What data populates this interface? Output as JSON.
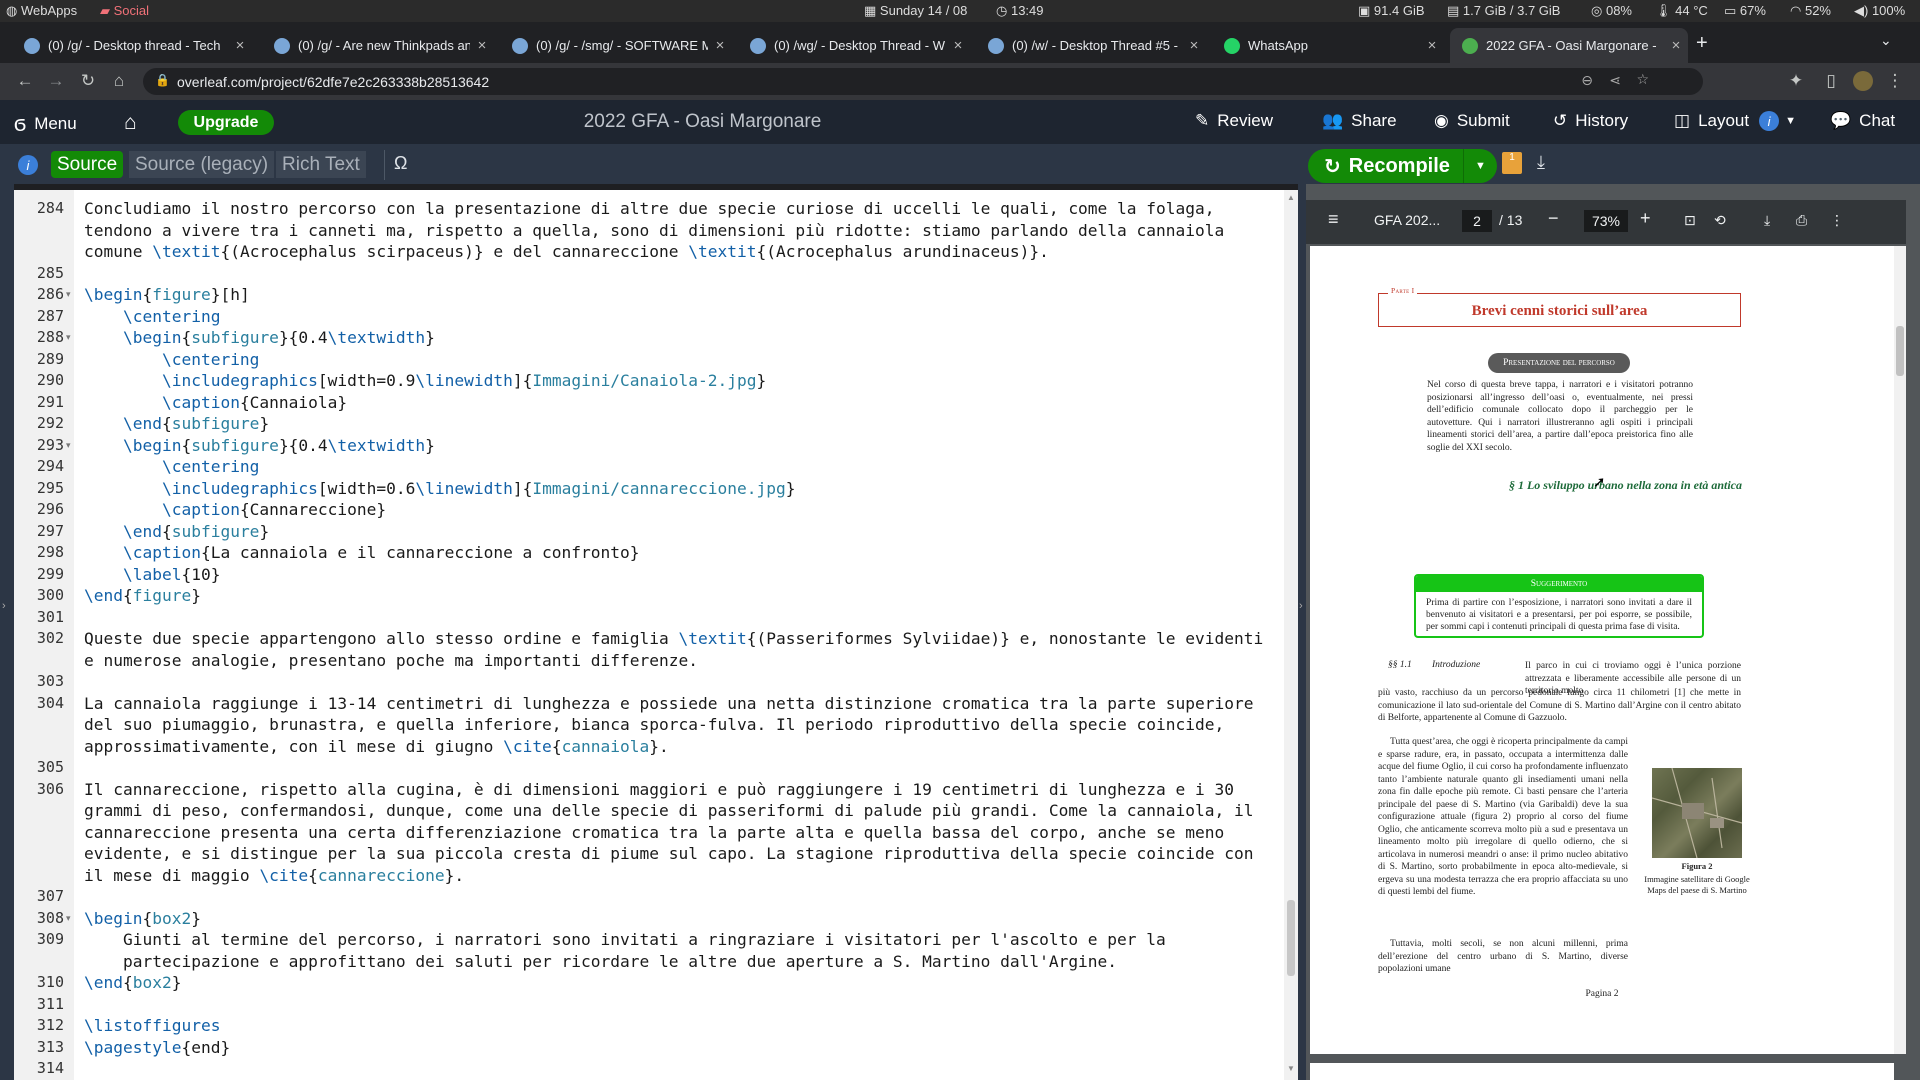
{
  "system_bar": {
    "webapps": "WebApps",
    "social": "Social",
    "date": "Sunday 14 / 08",
    "time": "13:49",
    "disk": "91.4 GiB",
    "memory": "1.7 GiB / 3.7 GiB",
    "cpu": "08%",
    "temp": "44 °C",
    "battery": "67%",
    "wifi": "52%",
    "volume": "100%"
  },
  "browser": {
    "tabs": [
      {
        "title": "(0) /g/ - Desktop thread - Tech",
        "favicon_color": "#7aa6d6"
      },
      {
        "title": "(0) /g/ - Are new Thinkpads an",
        "favicon_color": "#7aa6d6"
      },
      {
        "title": "(0) /g/ - /smg/ - SOFTWARE M",
        "favicon_color": "#7aa6d6"
      },
      {
        "title": "(0) /wg/ - Desktop Thread - W",
        "favicon_color": "#7aa6d6"
      },
      {
        "title": "(0) /w/ - Desktop Thread #5 -",
        "favicon_color": "#7aa6d6"
      },
      {
        "title": "WhatsApp",
        "favicon_color": "#25d366"
      },
      {
        "title": "2022 GFA - Oasi Margonare -",
        "favicon_color": "#4cae4f"
      }
    ],
    "new_tab": "+",
    "url": "overleaf.com/project/62dfe7e2c263338b28513642"
  },
  "overleaf": {
    "menu": "Menu",
    "upgrade": "Upgrade",
    "project_title": "2022 GFA - Oasi Margonare",
    "review": "Review",
    "share": "Share",
    "submit": "Submit",
    "history": "History",
    "layout": "Layout",
    "chat": "Chat",
    "modes": {
      "source": "Source",
      "legacy": "Source (legacy)",
      "rich": "Rich Text"
    },
    "omega": "Ω",
    "recompile": "Recompile",
    "logs_badge": "1"
  },
  "editor_lines": [
    {
      "n": "284",
      "fold": "",
      "segs": [
        {
          "t": "Concludiamo il nostro percorso con la presentazione di altre due specie curiose di uccelli le quali, come la folaga,"
        }
      ]
    },
    {
      "n": "",
      "fold": "",
      "segs": [
        {
          "t": "tendono a vivere tra i canneti ma, rispetto a quella, sono di dimensioni più ridotte: stiamo parlando della cannaiola"
        }
      ]
    },
    {
      "n": "",
      "fold": "",
      "segs": [
        {
          "t": "comune "
        },
        {
          "t": "\\textit",
          "c": "cmd"
        },
        {
          "t": "{(Acrocephalus scirpaceus)} e del cannareccione "
        },
        {
          "t": "\\textit",
          "c": "cmd"
        },
        {
          "t": "{(Acrocephalus arundinaceus)}."
        }
      ]
    },
    {
      "n": "285",
      "fold": "",
      "segs": [
        {
          "t": ""
        }
      ]
    },
    {
      "n": "286",
      "fold": "▾",
      "segs": [
        {
          "t": "\\begin",
          "c": "cmd"
        },
        {
          "t": "{"
        },
        {
          "t": "figure",
          "c": "arg"
        },
        {
          "t": "}[h]"
        }
      ]
    },
    {
      "n": "287",
      "fold": "",
      "segs": [
        {
          "t": "    "
        },
        {
          "t": "\\centering",
          "c": "cmd"
        }
      ]
    },
    {
      "n": "288",
      "fold": "▾",
      "segs": [
        {
          "t": "    "
        },
        {
          "t": "\\begin",
          "c": "cmd"
        },
        {
          "t": "{"
        },
        {
          "t": "subfigure",
          "c": "arg"
        },
        {
          "t": "}{0.4"
        },
        {
          "t": "\\textwidth",
          "c": "cmd"
        },
        {
          "t": "}"
        }
      ]
    },
    {
      "n": "289",
      "fold": "",
      "segs": [
        {
          "t": "        "
        },
        {
          "t": "\\centering",
          "c": "cmd"
        }
      ]
    },
    {
      "n": "290",
      "fold": "",
      "segs": [
        {
          "t": "        "
        },
        {
          "t": "\\includegraphics",
          "c": "cmd"
        },
        {
          "t": "[width=0.9"
        },
        {
          "t": "\\linewidth",
          "c": "cmd"
        },
        {
          "t": "]{"
        },
        {
          "t": "Immagini/Canaiola-2.jpg",
          "c": "arg"
        },
        {
          "t": "}"
        }
      ]
    },
    {
      "n": "291",
      "fold": "",
      "segs": [
        {
          "t": "        "
        },
        {
          "t": "\\caption",
          "c": "cmd"
        },
        {
          "t": "{Cannaiola}"
        }
      ]
    },
    {
      "n": "292",
      "fold": "",
      "segs": [
        {
          "t": "    "
        },
        {
          "t": "\\end",
          "c": "cmd"
        },
        {
          "t": "{"
        },
        {
          "t": "subfigure",
          "c": "arg"
        },
        {
          "t": "}"
        }
      ]
    },
    {
      "n": "293",
      "fold": "▾",
      "segs": [
        {
          "t": "    "
        },
        {
          "t": "\\begin",
          "c": "cmd"
        },
        {
          "t": "{"
        },
        {
          "t": "subfigure",
          "c": "arg"
        },
        {
          "t": "}{0.4"
        },
        {
          "t": "\\textwidth",
          "c": "cmd"
        },
        {
          "t": "}"
        }
      ]
    },
    {
      "n": "294",
      "fold": "",
      "segs": [
        {
          "t": "        "
        },
        {
          "t": "\\centering",
          "c": "cmd"
        }
      ]
    },
    {
      "n": "295",
      "fold": "",
      "segs": [
        {
          "t": "        "
        },
        {
          "t": "\\includegraphics",
          "c": "cmd"
        },
        {
          "t": "[width=0.6"
        },
        {
          "t": "\\linewidth",
          "c": "cmd"
        },
        {
          "t": "]{"
        },
        {
          "t": "Immagini/cannareccione.jpg",
          "c": "arg"
        },
        {
          "t": "}"
        }
      ]
    },
    {
      "n": "296",
      "fold": "",
      "segs": [
        {
          "t": "        "
        },
        {
          "t": "\\caption",
          "c": "cmd"
        },
        {
          "t": "{Cannareccione}"
        }
      ]
    },
    {
      "n": "297",
      "fold": "",
      "segs": [
        {
          "t": "    "
        },
        {
          "t": "\\end",
          "c": "cmd"
        },
        {
          "t": "{"
        },
        {
          "t": "subfigure",
          "c": "arg"
        },
        {
          "t": "}"
        }
      ]
    },
    {
      "n": "298",
      "fold": "",
      "segs": [
        {
          "t": "    "
        },
        {
          "t": "\\caption",
          "c": "cmd"
        },
        {
          "t": "{La cannaiola e il cannareccione a confronto}"
        }
      ]
    },
    {
      "n": "299",
      "fold": "",
      "segs": [
        {
          "t": "    "
        },
        {
          "t": "\\label",
          "c": "cmd"
        },
        {
          "t": "{10}"
        }
      ]
    },
    {
      "n": "300",
      "fold": "",
      "segs": [
        {
          "t": "\\end",
          "c": "cmd"
        },
        {
          "t": "{"
        },
        {
          "t": "figure",
          "c": "arg"
        },
        {
          "t": "}"
        }
      ]
    },
    {
      "n": "301",
      "fold": "",
      "segs": [
        {
          "t": ""
        }
      ]
    },
    {
      "n": "302",
      "fold": "",
      "segs": [
        {
          "t": "Queste due specie appartengono allo stesso ordine e famiglia "
        },
        {
          "t": "\\textit",
          "c": "cmd"
        },
        {
          "t": "{(Passeriformes Sylviidae)} e, nonostante le evidenti"
        }
      ]
    },
    {
      "n": "",
      "fold": "",
      "segs": [
        {
          "t": "e numerose analogie, presentano poche ma importanti differenze."
        }
      ]
    },
    {
      "n": "303",
      "fold": "",
      "segs": [
        {
          "t": ""
        }
      ]
    },
    {
      "n": "304",
      "fold": "",
      "segs": [
        {
          "t": "La cannaiola raggiunge i 13-14 centimetri di lunghezza e possiede una netta distinzione cromatica tra la parte superiore"
        }
      ]
    },
    {
      "n": "",
      "fold": "",
      "segs": [
        {
          "t": "del suo piumaggio, brunastra, e quella inferiore, bianca sporca-fulva. Il periodo riproduttivo della specie coincide,"
        }
      ]
    },
    {
      "n": "",
      "fold": "",
      "segs": [
        {
          "t": "approssimativamente, con il mese di giugno "
        },
        {
          "t": "\\cite",
          "c": "cmd"
        },
        {
          "t": "{"
        },
        {
          "t": "cannaiola",
          "c": "arg"
        },
        {
          "t": "}."
        }
      ]
    },
    {
      "n": "305",
      "fold": "",
      "segs": [
        {
          "t": ""
        }
      ]
    },
    {
      "n": "306",
      "fold": "",
      "segs": [
        {
          "t": "Il cannareccione, rispetto alla cugina, è di dimensioni maggiori e può raggiungere i 19 centimetri di lunghezza e i 30"
        }
      ]
    },
    {
      "n": "",
      "fold": "",
      "segs": [
        {
          "t": "grammi di peso, confermandosi, dunque, come una delle specie di passeriformi di palude più grandi. Come la cannaiola, il"
        }
      ]
    },
    {
      "n": "",
      "fold": "",
      "segs": [
        {
          "t": "cannareccione presenta una certa differenziazione cromatica tra la parte alta e quella bassa del corpo, anche se meno"
        }
      ]
    },
    {
      "n": "",
      "fold": "",
      "segs": [
        {
          "t": "evidente, e si distingue per la sua piccola cresta di piume sul capo. La stagione riproduttiva della specie coincide con"
        }
      ]
    },
    {
      "n": "",
      "fold": "",
      "segs": [
        {
          "t": "il mese di maggio "
        },
        {
          "t": "\\cite",
          "c": "cmd"
        },
        {
          "t": "{"
        },
        {
          "t": "cannareccione",
          "c": "arg"
        },
        {
          "t": "}."
        }
      ]
    },
    {
      "n": "307",
      "fold": "",
      "segs": [
        {
          "t": ""
        }
      ]
    },
    {
      "n": "308",
      "fold": "▾",
      "segs": [
        {
          "t": "\\begin",
          "c": "cmd"
        },
        {
          "t": "{"
        },
        {
          "t": "box2",
          "c": "arg"
        },
        {
          "t": "}"
        }
      ]
    },
    {
      "n": "309",
      "fold": "",
      "segs": [
        {
          "t": "    Giunti al termine del percorso, i narratori sono invitati a ringraziare i visitatori per l'ascolto e per la"
        }
      ]
    },
    {
      "n": "",
      "fold": "",
      "segs": [
        {
          "t": "    partecipazione e approfittano dei saluti per ricordare le altre due aperture a S. Martino dall'Argine."
        }
      ]
    },
    {
      "n": "310",
      "fold": "",
      "segs": [
        {
          "t": "\\end",
          "c": "cmd"
        },
        {
          "t": "{"
        },
        {
          "t": "box2",
          "c": "arg"
        },
        {
          "t": "}"
        }
      ]
    },
    {
      "n": "311",
      "fold": "",
      "segs": [
        {
          "t": ""
        }
      ]
    },
    {
      "n": "312",
      "fold": "",
      "segs": [
        {
          "t": "\\listoffigures",
          "c": "cmd"
        }
      ]
    },
    {
      "n": "313",
      "fold": "",
      "segs": [
        {
          "t": "\\pagestyle",
          "c": "cmd"
        },
        {
          "t": "{end}"
        }
      ]
    },
    {
      "n": "314",
      "fold": "",
      "segs": [
        {
          "t": ""
        }
      ]
    }
  ],
  "pdf": {
    "doc_name": "GFA 202...",
    "page_current": "2",
    "page_total": "/ 13",
    "zoom": "73%",
    "part_label": "Parte I",
    "part_title": "Brevi cenni storici sull’area",
    "badge": "Presentazione del percorso",
    "intro": "Nel corso di questa breve tappa, i narratori e i visitatori potranno posizionarsi all’ingresso dell’oasi o, eventualmente, nei pressi dell’edificio comunale collocato dopo il parcheggio per le autovetture. Qui i narratori illustreranno agli ospiti i principali lineamenti storici dell’area, a partire dall’epoca preistorica fino alle soglie del XXI secolo.",
    "section": "§ 1   Lo sviluppo urbano nella zona in età antica",
    "tip_title": "Suggerimento",
    "tip_body": "Prima di partire con l’esposizione, i narratori sono invitati a dare il benvenuto ai visitatori e a presentarsi, per poi esporre, se possibile, per sommi capi i contenuti principali di questa prima fase di visita.",
    "subsection_num": "§§ 1.1",
    "subsection_title": "Introduzione",
    "para1_right": "Il parco in cui ci troviamo oggi è l’unica porzione attrezzata e liberamente accessibile alle persone di un territorio molto",
    "para1_full": "più vasto, racchiuso da un percorso pedonale lungo circa 11 chilometri [1] che mette in comunicazione il lato sud-orientale del Comune di S. Martino dall’Argine con il centro abitato di Belforte, appartenente al Comune di Gazzuolo.",
    "para2": "Tutta quest’area, che oggi è ricoperta principalmente da campi e sparse radure, era, in passato, occupata a intermittenza dalle acque del fiume Oglio, il cui corso ha profondamente influenzato tanto l’ambiente naturale quanto gli insediamenti umani nella zona fin dalle epoche più remote. Ci basti pensare che l’arteria principale del paese di S. Martino (via Garibaldi) deve la sua configurazione attuale (figura 2) proprio al corso del fiume Oglio, che anticamente scorreva molto più a sud e presentava un lineamento molto più irregolare di quello odierno, che si articolava in numerosi meandri o anse: il primo nucleo abitativo di S. Martino, sorto probabilmente in epoca alto-medievale, si ergeva su una modesta terrazza che era proprio affacciata su uno di questi lembi del fiume.",
    "para3": "Tuttavia, molti secoli, se non alcuni millenni, prima dell’erezione del centro urbano di S. Martino, diverse popolazioni umane",
    "figure_label": "Figura 2",
    "figure_caption": "Immagine satellitare di Google Maps del paese di S. Martino",
    "page_footer": "Pagina 2"
  },
  "colors": {
    "overleaf_green": "#138a07",
    "editor_command": "#1260a7",
    "editor_argument": "#2a7f9e",
    "part_title_red": "#c0392b",
    "section_green": "#1e6b3a",
    "tip_green": "#16c416"
  }
}
